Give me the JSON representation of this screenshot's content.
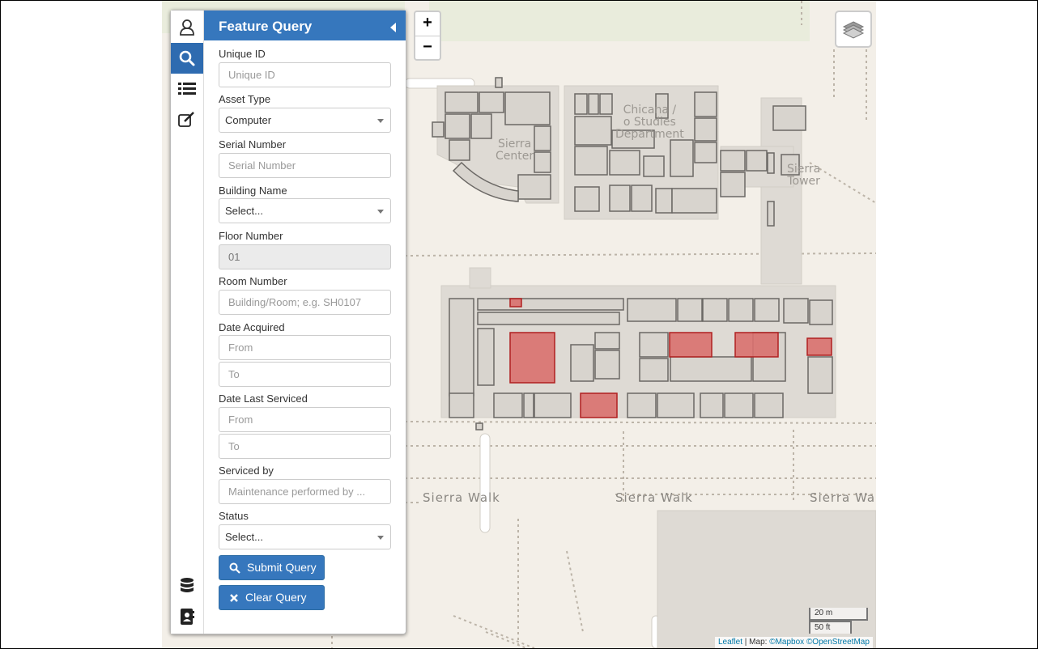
{
  "sidebar": {
    "tabs": [
      {
        "icon": "user-icon"
      },
      {
        "icon": "search-icon",
        "active": true
      },
      {
        "icon": "list-icon"
      },
      {
        "icon": "edit-icon"
      }
    ],
    "bottom_tabs": [
      {
        "icon": "database-icon"
      },
      {
        "icon": "contacts-icon"
      }
    ],
    "title": "Feature Query",
    "fields": {
      "unique_id": {
        "label": "Unique ID",
        "placeholder": "Unique ID"
      },
      "asset_type": {
        "label": "Asset Type",
        "value": "Computer"
      },
      "serial_number": {
        "label": "Serial Number",
        "placeholder": "Serial Number"
      },
      "building_name": {
        "label": "Building Name",
        "value": "Select..."
      },
      "floor_number": {
        "label": "Floor Number",
        "value": "01"
      },
      "room_number": {
        "label": "Room Number",
        "placeholder": "Building/Room; e.g. SH0107"
      },
      "date_acquired": {
        "label": "Date Acquired",
        "from": "From",
        "to": "To"
      },
      "date_last_serviced": {
        "label": "Date Last Serviced",
        "from": "From",
        "to": "To"
      },
      "serviced_by": {
        "label": "Serviced by",
        "placeholder": "Maintenance performed by ..."
      },
      "status": {
        "label": "Status",
        "value": "Select..."
      }
    },
    "submit_label": "Submit Query",
    "clear_label": "Clear Query"
  },
  "map": {
    "labels": {
      "walk1": "Sierra Walk",
      "walk2": "Sierra Walk",
      "walk3": "Sierra Wal",
      "sierra_center": "Sierra\nCenter",
      "chicana": "Chicana /\no Studies\nDepartment",
      "sierra_tower": "Sierra\nTower"
    },
    "zoom_in": "+",
    "zoom_out": "−",
    "scale": {
      "metric": "20 m",
      "imperial": "50 ft"
    },
    "attribution": {
      "leaflet": "Leaflet",
      "sep": " | Map: ",
      "mapbox": "©Mapbox",
      "osm": "©OpenStreetMap"
    },
    "highlight_color": "#d9706e"
  }
}
